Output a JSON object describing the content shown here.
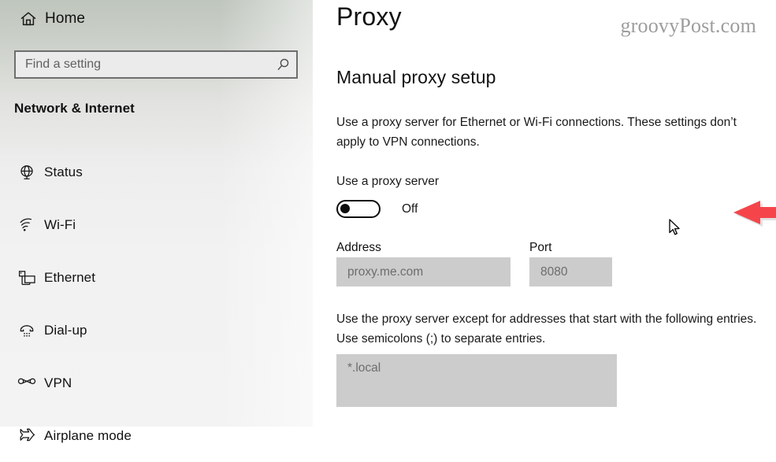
{
  "sidebar": {
    "home": {
      "label": "Home",
      "icon": "home-icon"
    },
    "search": {
      "placeholder": "Find a setting",
      "value": "",
      "icon": "search-icon"
    },
    "section_title": "Network & Internet",
    "items": [
      {
        "label": "Status",
        "icon": "globe-icon"
      },
      {
        "label": "Wi-Fi",
        "icon": "wifi-icon"
      },
      {
        "label": "Ethernet",
        "icon": "ethernet-icon"
      },
      {
        "label": "Dial-up",
        "icon": "dialup-phone-icon"
      },
      {
        "label": "VPN",
        "icon": "vpn-key-icon"
      },
      {
        "label": "Airplane mode",
        "icon": "airplane-icon"
      }
    ]
  },
  "content": {
    "page_title": "Proxy",
    "watermark": "groovyPost.com",
    "subhead": "Manual proxy setup",
    "description": "Use a proxy server for Ethernet or Wi-Fi connections. These settings don’t apply to VPN connections.",
    "toggle": {
      "label": "Use a proxy server",
      "state_text": "Off",
      "checked": false
    },
    "address": {
      "label": "Address",
      "placeholder": "proxy.me.com",
      "value": ""
    },
    "port": {
      "label": "Port",
      "placeholder": "8080",
      "value": ""
    },
    "exceptions": {
      "description": "Use the proxy server except for addresses that start with the following entries. Use semicolons (;) to separate entries.",
      "placeholder": "*.local",
      "value": ""
    },
    "annotation": {
      "icon": "red-left-arrow-annotation",
      "color": "#f5454b"
    },
    "cursor": {
      "icon": "mouse-pointer-cursor"
    }
  },
  "colors": {
    "accent_red": "#f5454b",
    "sidebar_top": "#bfc6bd",
    "sidebar_bottom": "#f3f3f3",
    "disabled_field": "#cccccc",
    "placeholder_text": "#6d6d6d"
  }
}
